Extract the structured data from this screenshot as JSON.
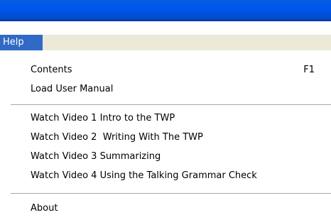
{
  "menu": {
    "title": "Help",
    "items": [
      {
        "label": "Contents",
        "shortcut": "F1"
      },
      {
        "label": "Load User Manual"
      },
      {
        "label": "Watch Video 1 Intro to the TWP"
      },
      {
        "label": "Watch Video 2  Writing With The TWP"
      },
      {
        "label": "Watch Video 3 Summarizing"
      },
      {
        "label": "Watch Video 4 Using the Talking Grammar Check"
      },
      {
        "label": "About"
      }
    ]
  },
  "colors": {
    "titlebar": "#0054e3",
    "menubar": "#ece9d8",
    "highlight": "#316ac5",
    "separator": "#aca899"
  }
}
